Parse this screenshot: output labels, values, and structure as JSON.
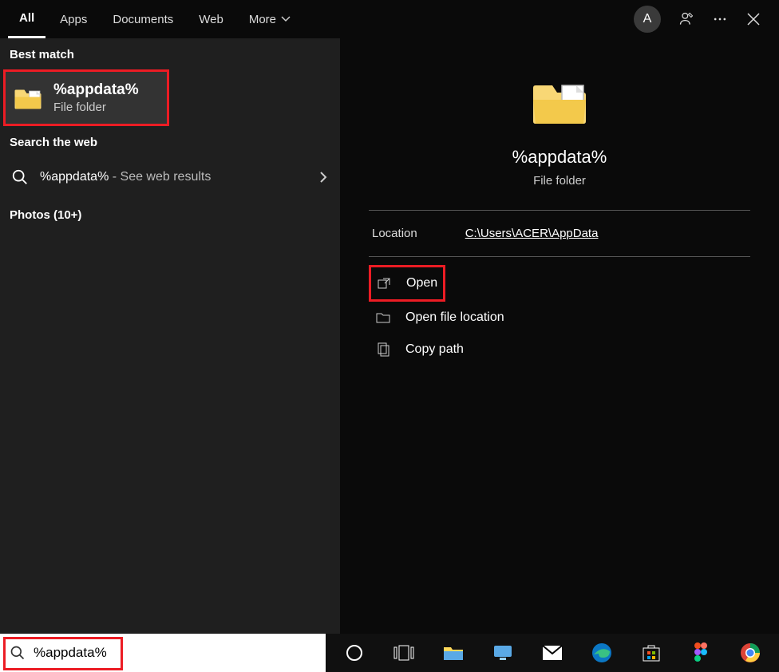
{
  "topbar": {
    "tabs": [
      {
        "label": "All",
        "active": true
      },
      {
        "label": "Apps",
        "active": false
      },
      {
        "label": "Documents",
        "active": false
      },
      {
        "label": "Web",
        "active": false
      },
      {
        "label": "More",
        "active": false,
        "dropdown": true
      }
    ],
    "avatar_letter": "A"
  },
  "left": {
    "best_match_label": "Best match",
    "best_match": {
      "title": "%appdata%",
      "subtitle": "File folder"
    },
    "search_web_label": "Search the web",
    "web_result": {
      "query": "%appdata%",
      "suffix": " - See web results"
    },
    "photos_label": "Photos (10+)"
  },
  "preview": {
    "title": "%appdata%",
    "subtitle": "File folder",
    "location_label": "Location",
    "location_path": "C:\\Users\\ACER\\AppData",
    "actions": {
      "open": "Open",
      "open_location": "Open file location",
      "copy_path": "Copy path"
    }
  },
  "search": {
    "value": "%appdata%"
  },
  "highlights": {
    "best_match": true,
    "open_action": true,
    "search_box": true
  }
}
